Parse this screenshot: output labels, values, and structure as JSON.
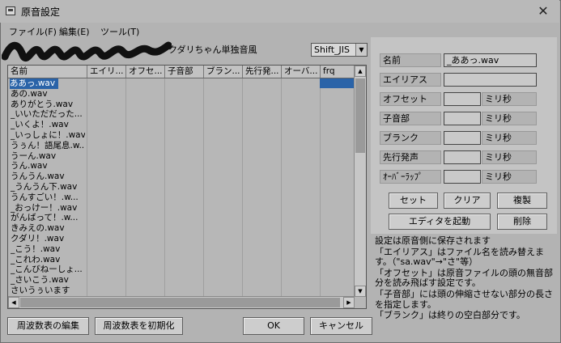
{
  "window": {
    "title": "原音設定",
    "close": "✕"
  },
  "menu": [
    "ファイル(F)",
    "編集(E)",
    "ツール(T)"
  ],
  "voice_label": "クダリちゃん単独音風",
  "encoding": {
    "value": "Shift_JIS"
  },
  "list": {
    "columns": [
      "名前",
      "エイリ...",
      "オフセ...",
      "子音部",
      "ブラン...",
      "先行発...",
      "オーバ...",
      "frq"
    ],
    "selected_index": 0,
    "rows": [
      "ああっ.wav",
      "あの.wav",
      "ありがとう.wav",
      "_いいただだった...",
      "_いくよ！.wav",
      "_いっしょに！.wav",
      "うぅん！語尾息.w...",
      "うーん.wav",
      "うん.wav",
      "うんうん.wav",
      "_うんうん下.wav",
      "うんすごい！.w...",
      "_おっけー！.wav",
      "がんばって！.w...",
      "きみえの.wav",
      "クダリ！.wav",
      "_こう！.wav",
      "_これわ.wav",
      "_こんびねーしょ...",
      "_さいこう.wav",
      "さいうぅいます"
    ]
  },
  "fields": {
    "name": {
      "label": "名前",
      "value": "_ああっ.wav"
    },
    "alias": {
      "label": "エイリアス",
      "value": ""
    },
    "offset": {
      "label": "オフセット",
      "value": "",
      "unit": "ミリ秒"
    },
    "consonant": {
      "label": "子音部",
      "value": "",
      "unit": "ミリ秒"
    },
    "blank": {
      "label": "ブランク",
      "value": "",
      "unit": "ミリ秒"
    },
    "preutterance": {
      "label": "先行発声",
      "value": "",
      "unit": "ミリ秒"
    },
    "overlap": {
      "label": "ｵｰﾊﾞｰﾗｯﾌﾟ",
      "value": "",
      "unit": "ミリ秒"
    }
  },
  "buttons": {
    "set": "セット",
    "clear": "クリア",
    "duplicate": "複製",
    "launch_editor": "エディタを起動",
    "delete": "削除",
    "edit_freq": "周波数表の編集",
    "init_freq": "周波数表を初期化",
    "ok": "OK",
    "cancel": "キャンセル"
  },
  "info": [
    "設定は原音側に保存されます",
    "「エイリアス」はファイル名を読み替えます。（\"sa.wav\"→\"さ\"等）",
    "「オフセット」は原音ファイルの頭の無音部分を読み飛ばす設定です。",
    "「子音部」には頭の伸縮させない部分の長さを指定します。",
    "「ブランク」は終りの空白部分です。"
  ]
}
